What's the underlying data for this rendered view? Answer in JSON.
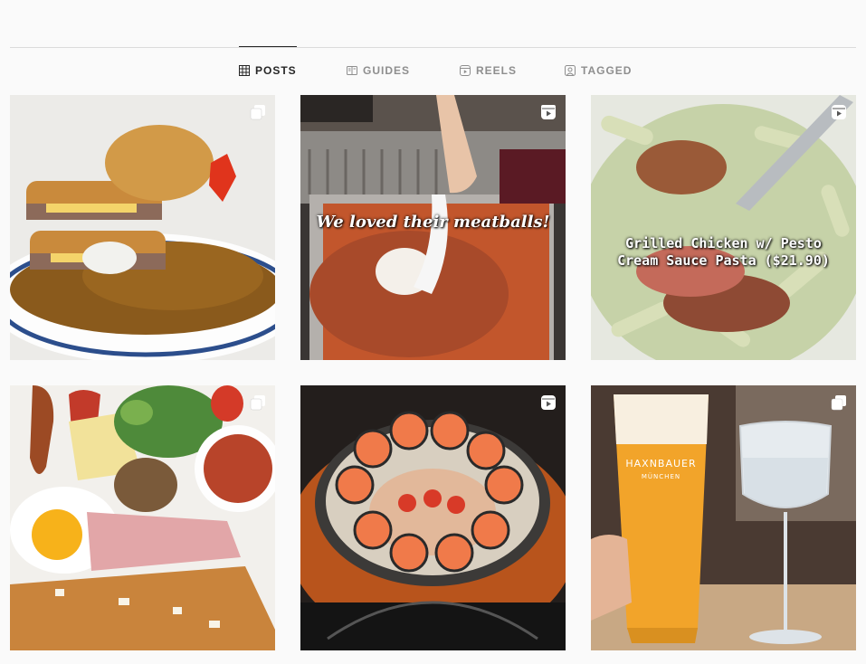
{
  "tabs": [
    {
      "label": "POSTS",
      "icon": "grid-icon",
      "active": true
    },
    {
      "label": "GUIDES",
      "icon": "guides-icon",
      "active": false
    },
    {
      "label": "REELS",
      "icon": "reels-icon",
      "active": false
    },
    {
      "label": "TAGGED",
      "icon": "tagged-icon",
      "active": false
    }
  ],
  "posts": [
    {
      "subject": "katsu curry",
      "badge": "carousel-icon",
      "caption": ""
    },
    {
      "subject": "hotpot meatballs",
      "badge": "reel-icon",
      "caption": "We loved their meatballs!"
    },
    {
      "subject": "pesto pasta",
      "badge": "reel-icon",
      "caption_line1": "Grilled Chicken w/ Pesto",
      "caption_line2": "Cream Sauce Pasta ($21.90)"
    },
    {
      "subject": "breakfast platter",
      "badge": "carousel-icon",
      "caption": ""
    },
    {
      "subject": "salmon sushi",
      "badge": "reel-icon",
      "caption": ""
    },
    {
      "subject": "beer",
      "badge": "carousel-icon",
      "caption": "",
      "glass_text_1": "HAXNBAUER",
      "glass_text_2": "MÜNCHEN"
    }
  ]
}
